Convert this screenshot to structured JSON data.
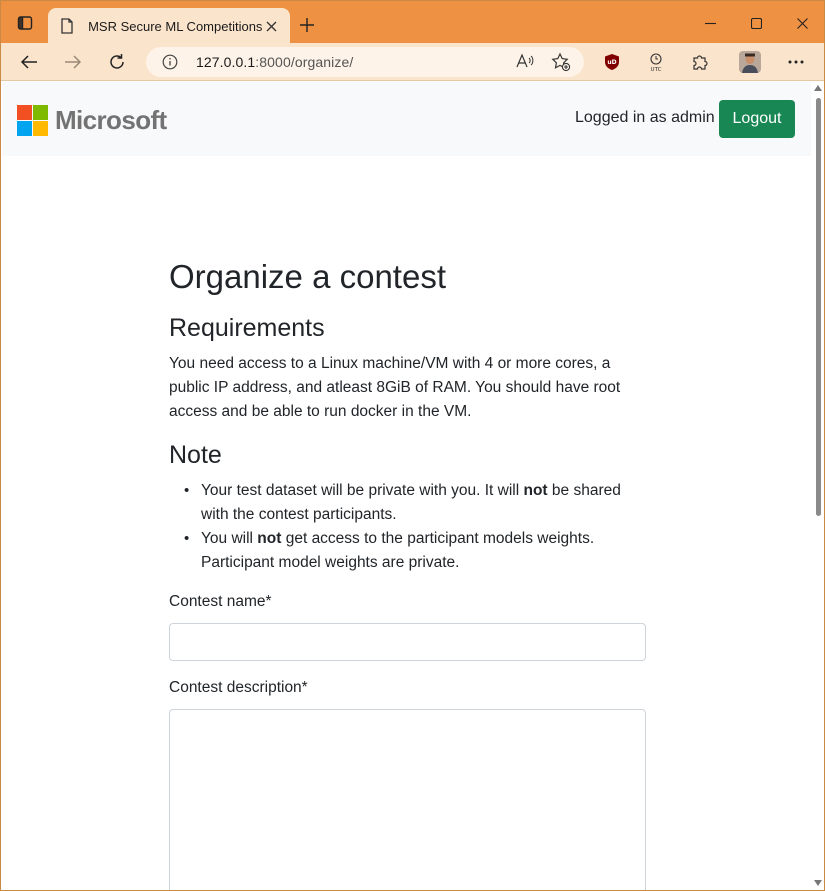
{
  "browser": {
    "tab_title": "MSR Secure ML Competitions",
    "url_host": "127.0.0.1",
    "url_rest": ":8000/organize/",
    "new_tab_symbol": "+",
    "icons": {
      "tab_actions": "tab-actions-icon",
      "page": "page-icon",
      "close_tab": "close-icon",
      "minimize": "minimize-icon",
      "maximize": "maximize-icon",
      "close_window": "close-icon",
      "back": "back-arrow-icon",
      "forward": "forward-arrow-icon",
      "refresh": "refresh-icon",
      "site_info": "info-icon",
      "read_aloud": "read-aloud-icon",
      "favorites": "add-favorite-icon",
      "ublock": "ublock-icon",
      "utc": "utc-clock-icon",
      "extensions": "puzzle-icon",
      "profile": "avatar",
      "menu": "more-icon"
    },
    "colors": {
      "titlebar": "#ee9143",
      "toolbar": "#fbe4cc"
    }
  },
  "navbar": {
    "brand": "Microsoft",
    "logo_colors": [
      "#f25022",
      "#7fba00",
      "#00a4ef",
      "#ffb900"
    ],
    "logged_in_text": "Logged in as admin",
    "logout_label": "Logout",
    "logout_color": "#198754"
  },
  "main": {
    "title": "Organize a contest",
    "requirements_heading": "Requirements",
    "requirements_text": "You need access to a Linux machine/VM with 4 or more cores, a public IP address, and atleast 8GiB of RAM. You should have root access and be able to run docker in the VM.",
    "note_heading": "Note",
    "notes": [
      {
        "before": "Your test dataset will be private with you. It will ",
        "bold": "not",
        "after": " be shared with the contest participants."
      },
      {
        "before": "You will ",
        "bold": "not",
        "after": " get access to the participant models weights. Participant model weights are private."
      }
    ],
    "form": {
      "name_label": "Contest name*",
      "name_value": "",
      "description_label": "Contest description*",
      "description_value": ""
    }
  }
}
